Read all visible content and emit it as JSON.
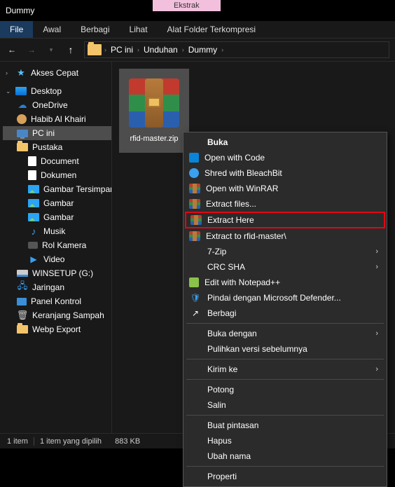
{
  "titlebar": {
    "title": "Dummy",
    "context_tab": "Ekstrak"
  },
  "tabs": {
    "file": "File",
    "home": "Awal",
    "share": "Berbagi",
    "view": "Lihat",
    "compressed": "Alat Folder Terkompresi"
  },
  "breadcrumb": {
    "root": "PC ini",
    "p1": "Unduhan",
    "p2": "Dummy"
  },
  "tree": {
    "quick": "Akses Cepat",
    "desktop": "Desktop",
    "onedrive": "OneDrive",
    "user": "Habib Al Khairi",
    "thispc": "PC ini",
    "libraries": "Pustaka",
    "document": "Document",
    "dokumen": "Dokumen",
    "saved_pictures": "Gambar Tersimpan",
    "gambar1": "Gambar",
    "gambar2": "Gambar",
    "musik": "Musik",
    "rol": "Rol Kamera",
    "video": "Video",
    "winsetup": "WINSETUP (G:)",
    "network": "Jaringan",
    "control": "Panel Kontrol",
    "recycle": "Keranjang Sampah",
    "webp": "Webp Export"
  },
  "file": {
    "name": "rfid-master.zip"
  },
  "menu": {
    "open": "Buka",
    "open_code": "Open with Code",
    "shred": "Shred with BleachBit",
    "open_winrar": "Open with WinRAR",
    "extract_files": "Extract files...",
    "extract_here": "Extract Here",
    "extract_to": "Extract to rfid-master\\",
    "sevenzip": "7-Zip",
    "crc": "CRC SHA",
    "notepad": "Edit with Notepad++",
    "defender": "Pindai dengan Microsoft Defender...",
    "share": "Berbagi",
    "open_with": "Buka dengan",
    "restore": "Pulihkan versi sebelumnya",
    "send_to": "Kirim ke",
    "cut": "Potong",
    "copy": "Salin",
    "shortcut": "Buat pintasan",
    "delete": "Hapus",
    "rename": "Ubah nama",
    "properties": "Properti"
  },
  "status": {
    "count": "1 item",
    "selection": "1 item yang dipilih",
    "size": "883 KB"
  }
}
